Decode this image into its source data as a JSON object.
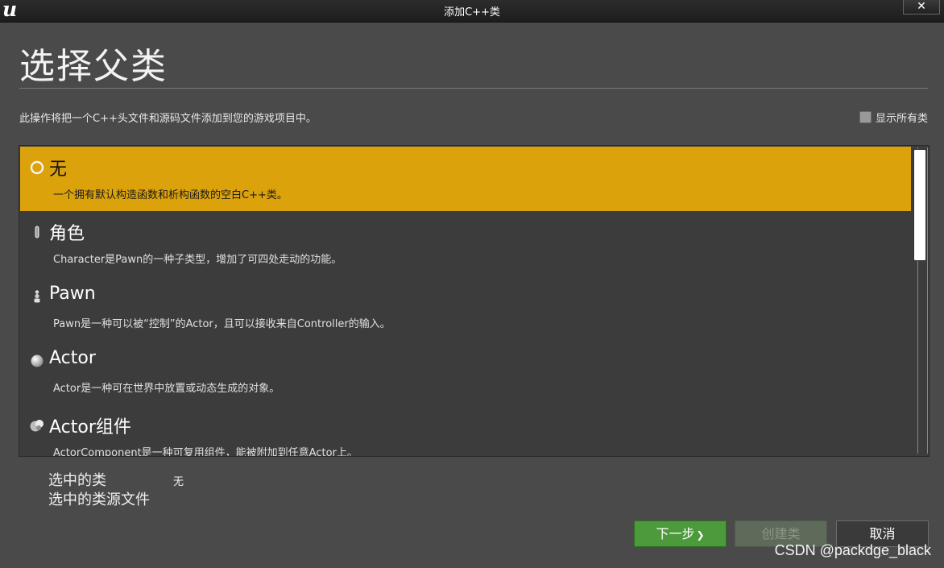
{
  "window": {
    "title": "添加C++类",
    "close_label": "✕",
    "logo": "u"
  },
  "page": {
    "heading": "选择父类",
    "description": "此操作将把一个C++头文件和源码文件添加到您的游戏项目中。",
    "show_all_label": "显示所有类",
    "show_all_checked": false
  },
  "class_list": {
    "items": [
      {
        "icon": "radio-ring-icon",
        "title": "无",
        "description": "一个拥有默认构造函数和析构函数的空白C++类。",
        "selected": true
      },
      {
        "icon": "character-icon",
        "title": "角色",
        "description": "Character是Pawn的一种子类型，增加了可四处走动的功能。",
        "selected": false
      },
      {
        "icon": "pawn-icon",
        "title": "Pawn",
        "description": "Pawn是一种可以被“控制”的Actor，且可以接收来自Controller的输入。",
        "selected": false
      },
      {
        "icon": "actor-sphere-icon",
        "title": "Actor",
        "description": "Actor是一种可在世界中放置或动态生成的对象。",
        "selected": false
      },
      {
        "icon": "component-icon",
        "title": "Actor组件",
        "description": "ActorComponent是一种可复用组件，能被附加到任意Actor上。",
        "selected": false
      }
    ]
  },
  "selection": {
    "class_label": "选中的类",
    "class_value": "无",
    "source_label": "选中的类源文件"
  },
  "buttons": {
    "next": "下一步",
    "create": "创建类",
    "cancel": "取消"
  },
  "watermark": "CSDN @packdge_black",
  "colors": {
    "selected_row": "#dca20c",
    "next_button": "#4c9a3c",
    "background": "#4a4a4a"
  }
}
